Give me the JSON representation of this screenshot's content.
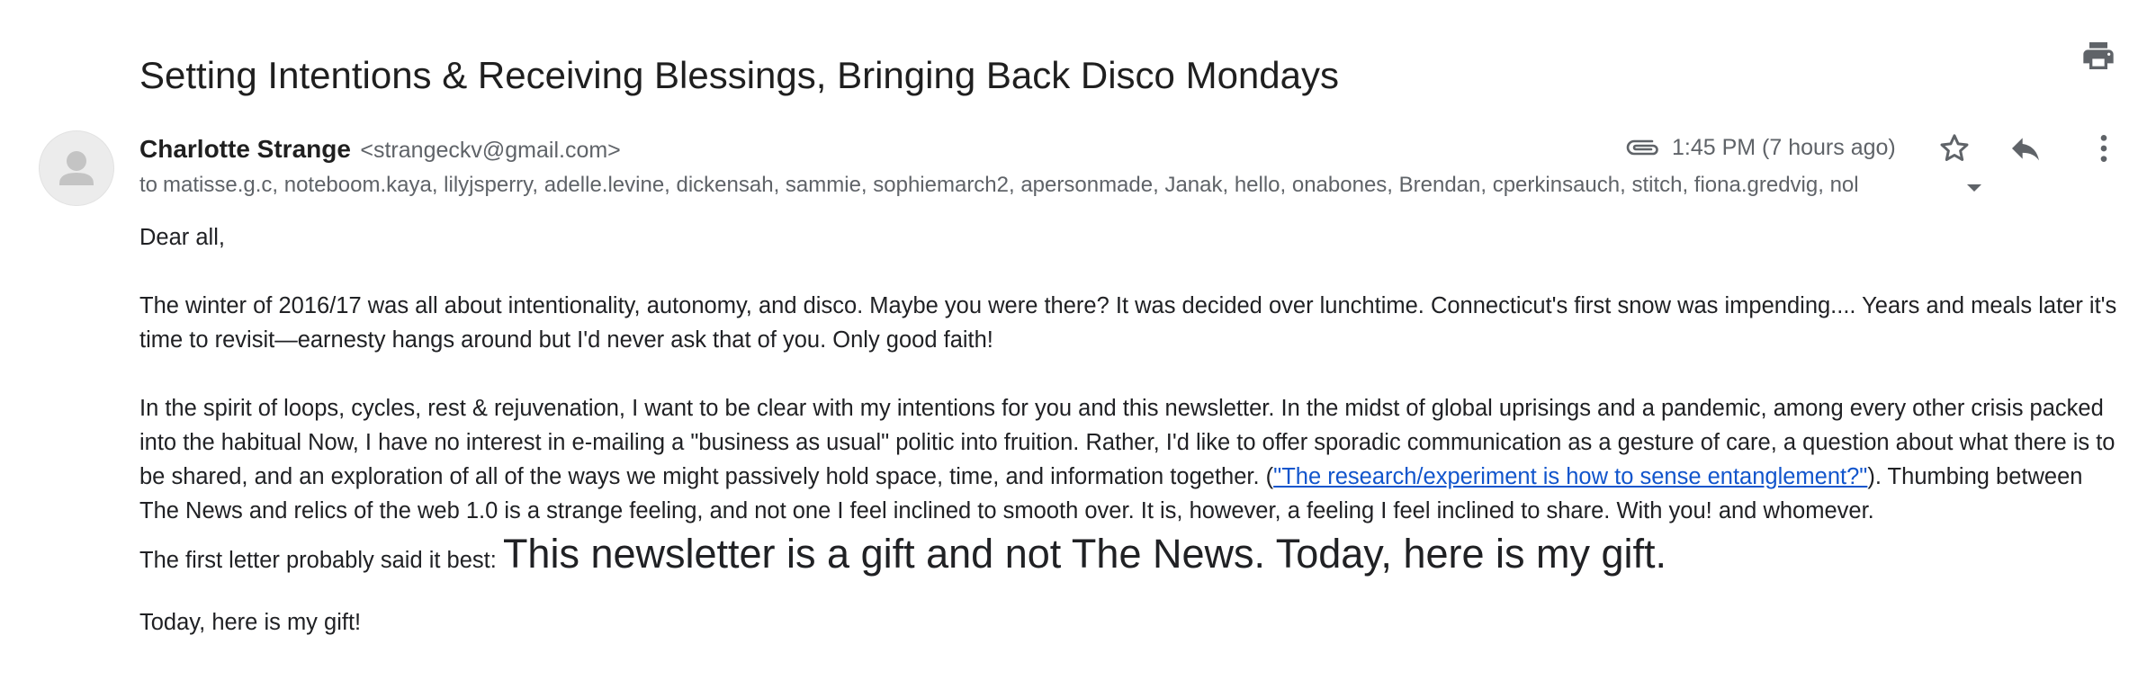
{
  "email": {
    "subject": "Setting Intentions & Receiving Blessings, Bringing Back Disco Mondays",
    "sender_name": "Charlotte Strange",
    "sender_email": "<strangeckv@gmail.com>",
    "time": "1:45 PM (7 hours ago)",
    "recipients_prefix": "to",
    "recipients": "matisse.g.c, noteboom.kaya, lilyjsperry, adelle.levine, dickensah, sammie, sophiemarch2, apersonmade, Janak, hello, onabones, Brendan, cperkinsauch, stitch, fiona.gredvig, nol"
  },
  "body": {
    "greeting": "Dear all,",
    "para1": "The winter of 2016/17 was all about intentionality, autonomy, and disco. Maybe you were there? It was decided over lunchtime. Connecticut's first snow was impending.... Years and meals later it's time to revisit—earnesty hangs around but I'd never ask that of you. Only good faith!",
    "para2_before_link": "In the spirit of loops, cycles, rest & rejuvenation, I want to be clear with my intentions for you and this newsletter. In the midst of global uprisings and a pandemic, among every other crisis packed into the habitual Now, I have no interest in e-mailing a \"business as usual\" politic into fruition. Rather, I'd like to offer sporadic communication as a gesture of care, a question about what there is to be shared, and an exploration of all of the ways we might passively hold space, time, and information together. (",
    "para2_link": "\"The research/experiment is how to sense entanglement?\"",
    "para2_after_link": "). Thumbing between The News and relics of the web 1.0 is a strange feeling, and not one I feel inclined to smooth over. It is, however, a feeling I feel inclined to share. With you! and whomever.",
    "para3_lead": "The first letter probably said it best: ",
    "para3_big": "This newsletter is a gift and not The News. Today, here is my gift.",
    "closing": "Today, here is my gift!"
  },
  "icons": {
    "print": "print-icon",
    "attachment": "paperclip-icon",
    "star": "star-icon",
    "reply": "reply-icon",
    "more": "more-vert-icon",
    "avatar": "person-icon",
    "expand": "caret-down-icon"
  },
  "colors": {
    "link": "#1155cc",
    "icon": "#5f6368",
    "text": "#202124"
  }
}
